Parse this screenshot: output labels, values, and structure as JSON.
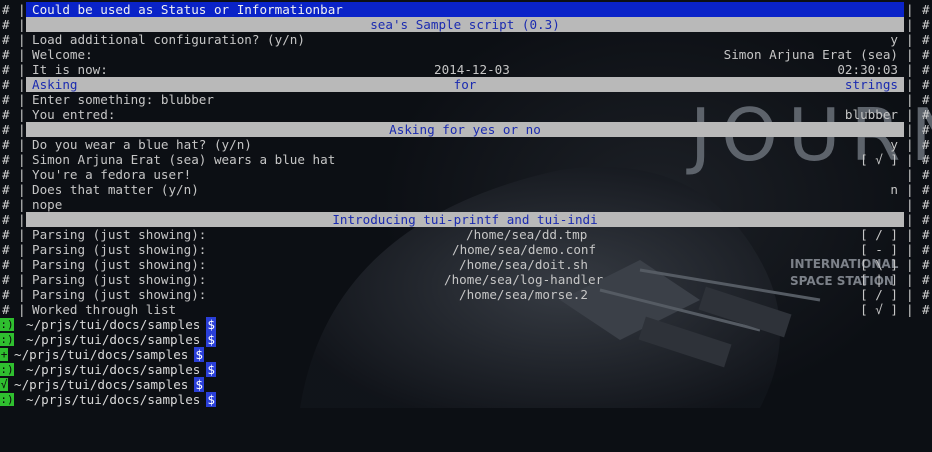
{
  "status_bar": "Could be used as Status or Informationbar",
  "header_title": "sea's Sample script (0.3)",
  "rows": {
    "load_config": {
      "label": "Load additional configuration? (y/n)",
      "value": "y"
    },
    "welcome": {
      "label": "Welcome:",
      "value": "Simon Arjuna Erat (sea)"
    },
    "now": {
      "label": "It is now:",
      "date": "2014-12-03",
      "time": "02:30:03"
    }
  },
  "asking_bar": {
    "left": "Asking",
    "center": "for",
    "right": "strings"
  },
  "strings_rows": {
    "enter": "Enter something: blubber",
    "entered_label": "You entred:",
    "entered_value": "blubber"
  },
  "yesno_bar": "Asking for yes or no",
  "yesno_rows": {
    "blue_hat_q": "Do you wear a blue hat? (y/n)",
    "blue_hat_a": "y",
    "blue_hat_stmt": "Simon Arjuna Erat (sea) wears a blue hat",
    "blue_hat_ind": "[ √ ]",
    "fedora": "You're a fedora user!",
    "matter_q": "Does that matter (y/n)",
    "matter_a": "n",
    "nope": "nope"
  },
  "printf_bar": "Introducing tui-printf and tui-indi",
  "parsing_rows": [
    {
      "label": "Parsing (just showing):",
      "path": "/home/sea/dd.tmp",
      "indicator": "[ / ]"
    },
    {
      "label": "Parsing (just showing):",
      "path": "/home/sea/demo.conf",
      "indicator": "[ - ]"
    },
    {
      "label": "Parsing (just showing):",
      "path": "/home/sea/doit.sh",
      "indicator": "[ \\ ]"
    },
    {
      "label": "Parsing (just showing):",
      "path": "/home/sea/log-handler",
      "indicator": "[ | ]"
    },
    {
      "label": "Parsing (just showing):",
      "path": "/home/sea/morse.2",
      "indicator": "[ / ]"
    }
  ],
  "worked_row": {
    "label": "Worked through list",
    "indicator": "[ √ ]"
  },
  "prompts": [
    {
      "mark": ":)",
      "path": "~/prjs/tui/docs/samples",
      "dollar": "$"
    },
    {
      "mark": ":)",
      "path": "~/prjs/tui/docs/samples",
      "dollar": "$"
    },
    {
      "mark": "+",
      "path": "~/prjs/tui/docs/samples",
      "dollar": "$"
    },
    {
      "mark": ":)",
      "path": "~/prjs/tui/docs/samples",
      "dollar": "$"
    },
    {
      "mark": "√",
      "path": "~/prjs/tui/docs/samples",
      "dollar": "$"
    },
    {
      "mark": ":)",
      "path": "~/prjs/tui/docs/samples",
      "dollar": "$"
    }
  ],
  "frame": {
    "outer": "#",
    "inner": "|"
  },
  "wallpaper": {
    "word": "JOURNE",
    "line1": "INTERNATIONAL",
    "line2": "SPACE STATION"
  },
  "colors": {
    "status_bar": "#0a23c8",
    "section_bar": "#b9b9b9",
    "section_text": "#1b2bb0",
    "prompt_mark": "#2fbf2f",
    "prompt_dollar": "#2a3fd8"
  }
}
